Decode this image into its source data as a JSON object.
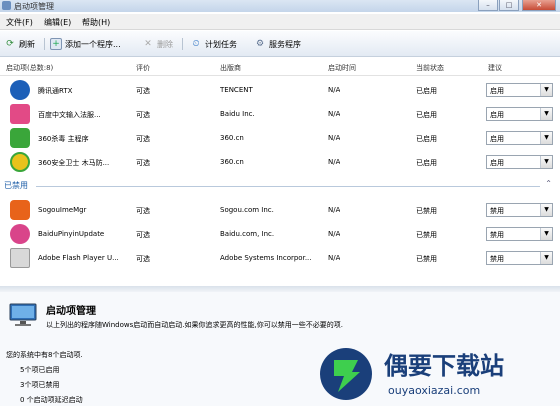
{
  "window": {
    "title": "启动项管理",
    "min": "–",
    "max": "□",
    "close": "✕"
  },
  "menu": [
    "文件(F)",
    "编辑(E)",
    "帮助(H)"
  ],
  "toolbar": {
    "refresh": "刷新",
    "add": "添加一个程序...",
    "delete": "删除",
    "schedule": "计划任务",
    "service": "服务程序"
  },
  "columns": [
    "启动项(总数:8)",
    "评价",
    "出版商",
    "启动时间",
    "当前状态",
    "建议"
  ],
  "enabled_items": [
    {
      "name": "腾讯通RTX",
      "rating": "可选",
      "publisher": "TENCENT",
      "time": "N/A",
      "status": "已启用",
      "advice": "启用",
      "icon": "rtx-icon",
      "color": "#1c5fb8"
    },
    {
      "name": "百度中文输入法服...",
      "rating": "可选",
      "publisher": "Baidu Inc.",
      "time": "N/A",
      "status": "已启用",
      "advice": "启用",
      "icon": "baidu-ime-icon",
      "color": "#e24a86"
    },
    {
      "name": "360杀毒 主程序",
      "rating": "可选",
      "publisher": "360.cn",
      "time": "N/A",
      "status": "已启用",
      "advice": "启用",
      "icon": "360-antivirus-icon",
      "color": "#3aa63a"
    },
    {
      "name": "360安全卫士 木马防...",
      "rating": "可选",
      "publisher": "360.cn",
      "time": "N/A",
      "status": "已启用",
      "advice": "启用",
      "icon": "360-safeguard-icon",
      "color": "#e9c21c"
    }
  ],
  "disabled_group": "已禁用",
  "disabled_items": [
    {
      "name": "SogouImeMgr",
      "rating": "可选",
      "publisher": "Sogou.com Inc.",
      "time": "N/A",
      "status": "已禁用",
      "advice": "禁用",
      "icon": "sogou-icon",
      "color": "#e8631a"
    },
    {
      "name": "BaiduPinyinUpdate",
      "rating": "可选",
      "publisher": "Baidu.com, Inc.",
      "time": "N/A",
      "status": "已禁用",
      "advice": "禁用",
      "icon": "baidu-pinyin-icon",
      "color": "#d9448a"
    },
    {
      "name": "Adobe Flash Player U...",
      "rating": "可选",
      "publisher": "Adobe Systems Incorpor...",
      "time": "N/A",
      "status": "已禁用",
      "advice": "禁用",
      "icon": "flash-player-icon",
      "color": "#8a8a8a"
    }
  ],
  "info": {
    "heading": "启动项管理",
    "description": "以上列出的程序随Windows启动而自动启动.如果你追求更高的性能,你可以禁用一些不必要的项.",
    "summary": "您的系统中有8个启动项.",
    "enabled_count": "5个项已启用",
    "disabled_count": "3个项已禁用",
    "delayed_count": "0 个启动项延迟启动"
  },
  "watermark": {
    "title": "偶要下载站",
    "url": "ouyaoxiazai.com"
  }
}
